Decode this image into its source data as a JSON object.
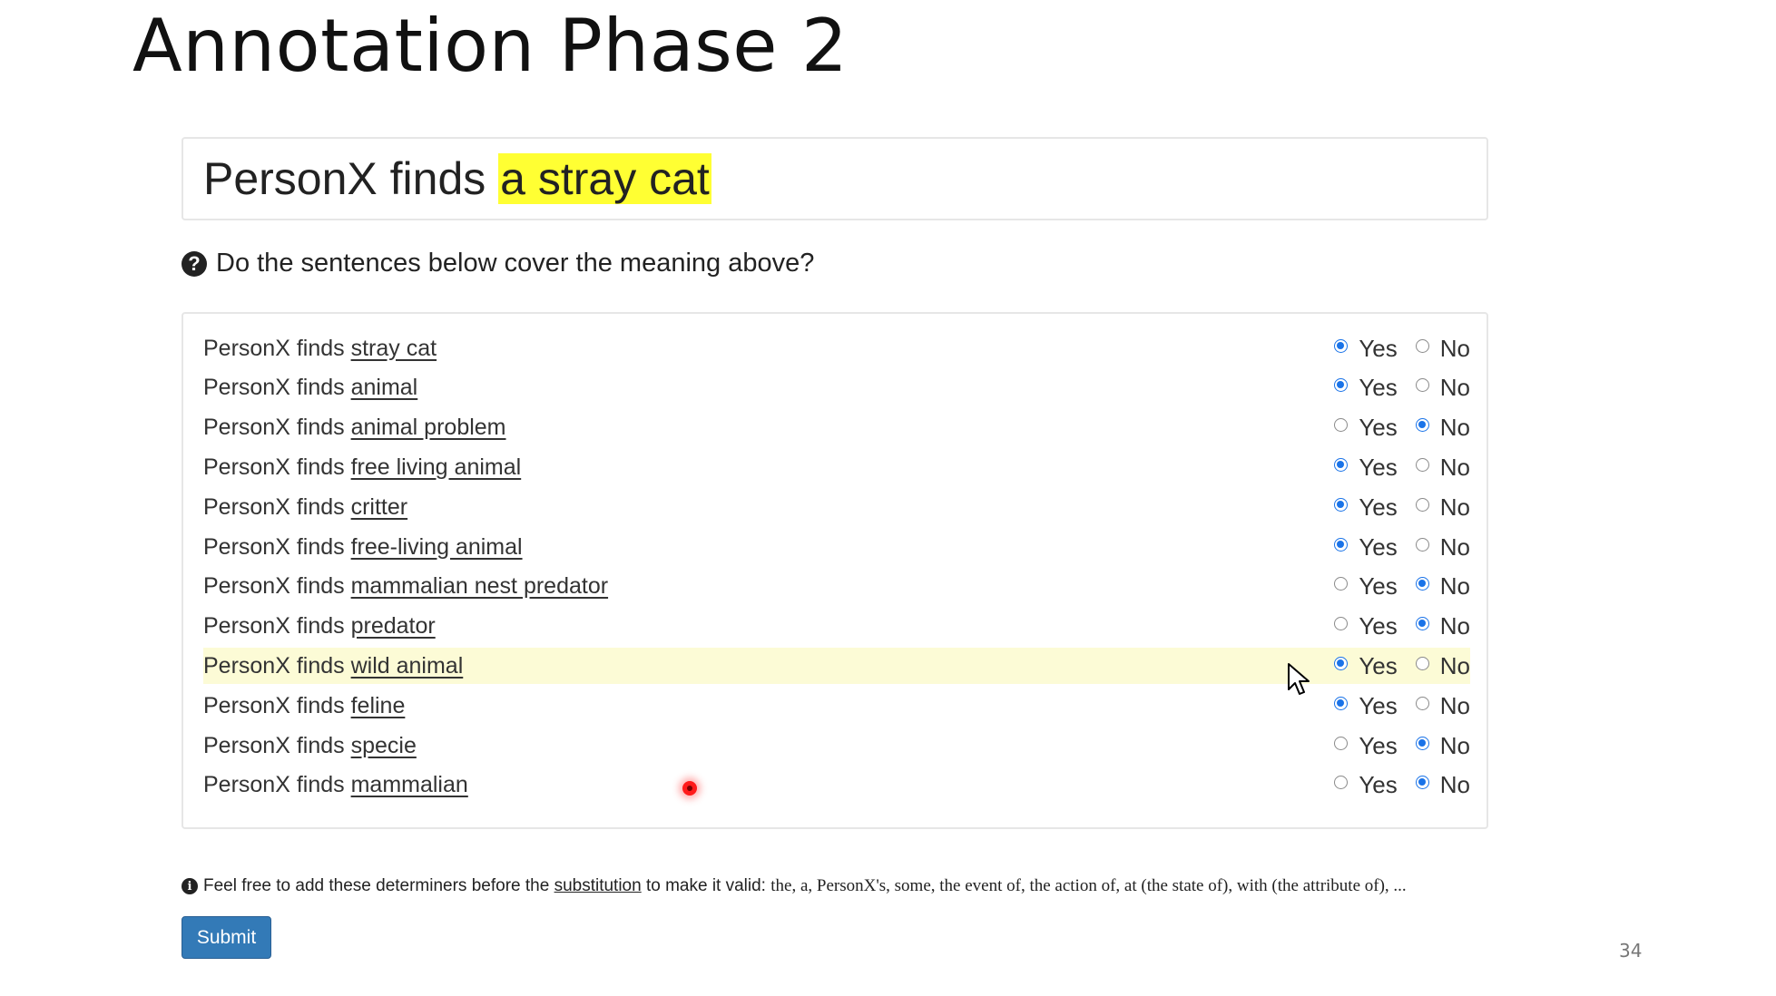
{
  "slide": {
    "title": "Annotation Phase 2",
    "page_number": "34"
  },
  "event": {
    "prefix": "PersonX finds ",
    "highlight": "a stray cat"
  },
  "question": {
    "icon": "question-circle-icon",
    "text": "Do the sentences below cover the meaning above?"
  },
  "choice_labels": {
    "yes": "Yes",
    "no": "No"
  },
  "rows": [
    {
      "prefix": "PersonX finds ",
      "substitution": "stray cat",
      "selected": "yes"
    },
    {
      "prefix": "PersonX finds ",
      "substitution": "animal",
      "selected": "yes"
    },
    {
      "prefix": "PersonX finds ",
      "substitution": "animal problem",
      "selected": "no"
    },
    {
      "prefix": "PersonX finds ",
      "substitution": "free living animal",
      "selected": "yes"
    },
    {
      "prefix": "PersonX finds ",
      "substitution": "critter",
      "selected": "yes"
    },
    {
      "prefix": "PersonX finds ",
      "substitution": "free-living animal",
      "selected": "yes"
    },
    {
      "prefix": "PersonX finds ",
      "substitution": "mammalian nest predator",
      "selected": "no"
    },
    {
      "prefix": "PersonX finds ",
      "substitution": "predator",
      "selected": "no"
    },
    {
      "prefix": "PersonX finds ",
      "substitution": "wild animal",
      "selected": "yes",
      "hovered": true
    },
    {
      "prefix": "PersonX finds ",
      "substitution": "feline",
      "selected": "yes"
    },
    {
      "prefix": "PersonX finds ",
      "substitution": "specie",
      "selected": "no"
    },
    {
      "prefix": "PersonX finds ",
      "substitution": "mammalian",
      "selected": "no"
    }
  ],
  "note": {
    "icon": "info-circle-icon",
    "before": "Feel free to add these determiners before the ",
    "link": "substitution",
    "middle": " to make it valid: ",
    "determiners": "the, a, PersonX's, some, the event of, the action of, at (the state of), with (the attribute of), ..."
  },
  "submit_label": "Submit",
  "colors": {
    "highlight": "#ffff33",
    "radio_selected": "#1a73e8",
    "submit_bg": "#337ab7",
    "hover_row": "#fcfbd6"
  }
}
